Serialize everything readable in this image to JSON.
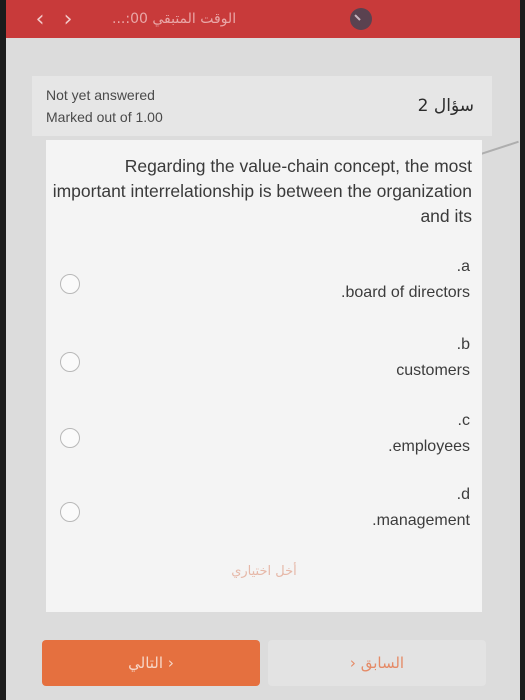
{
  "topbar": {
    "back_icon": "‹",
    "forward_icon": "›",
    "timer_text": "الوقت المتبقي 00:..."
  },
  "header": {
    "status": "Not yet answered",
    "marks": "Marked out of 1.00",
    "question_label": "سؤال 2"
  },
  "question": {
    "text": "Regarding the value-chain concept, the most important interrelationship is between the organization and its"
  },
  "options": [
    {
      "letter": ".a",
      "text": ".board of directors"
    },
    {
      "letter": ".b",
      "text": "customers"
    },
    {
      "letter": ".c",
      "text": ".employees"
    },
    {
      "letter": ".d",
      "text": ".management"
    }
  ],
  "clear_choice": "أخل اختياري",
  "buttons": {
    "next": "التالي ›",
    "prev": "› السابق"
  },
  "colors": {
    "topbar": "#c83a3a",
    "next_button": "#e5703f",
    "prev_text": "#e58a66"
  }
}
